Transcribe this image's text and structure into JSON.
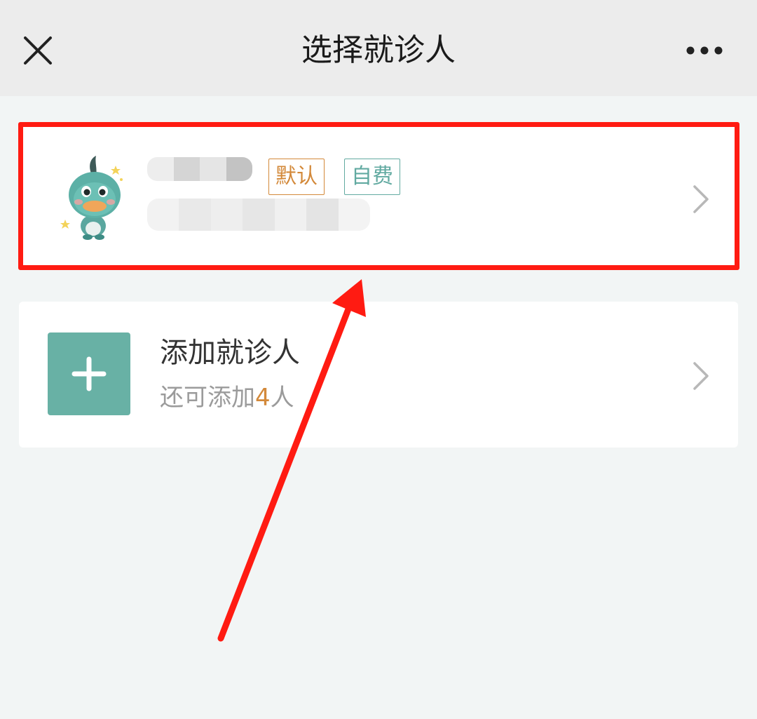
{
  "header": {
    "title": "选择就诊人",
    "close_icon": "close-icon",
    "more_icon": "more-icon"
  },
  "patient": {
    "tags": {
      "default": "默认",
      "self_pay": "自费"
    },
    "avatar_icon": "duck-avatar-icon",
    "chevron_icon": "chevron-right-icon"
  },
  "add_patient": {
    "title": "添加就诊人",
    "subtitle_prefix": "还可添加",
    "remaining_count": "4",
    "subtitle_suffix": "人",
    "icon": "plus-icon"
  },
  "colors": {
    "header_bg": "#ececec",
    "page_bg": "#f2f5f5",
    "accent_orange": "#d3893a",
    "accent_teal": "#62aaa1",
    "add_icon_bg": "#68b1a5",
    "annotation_red": "#ff1b12"
  }
}
